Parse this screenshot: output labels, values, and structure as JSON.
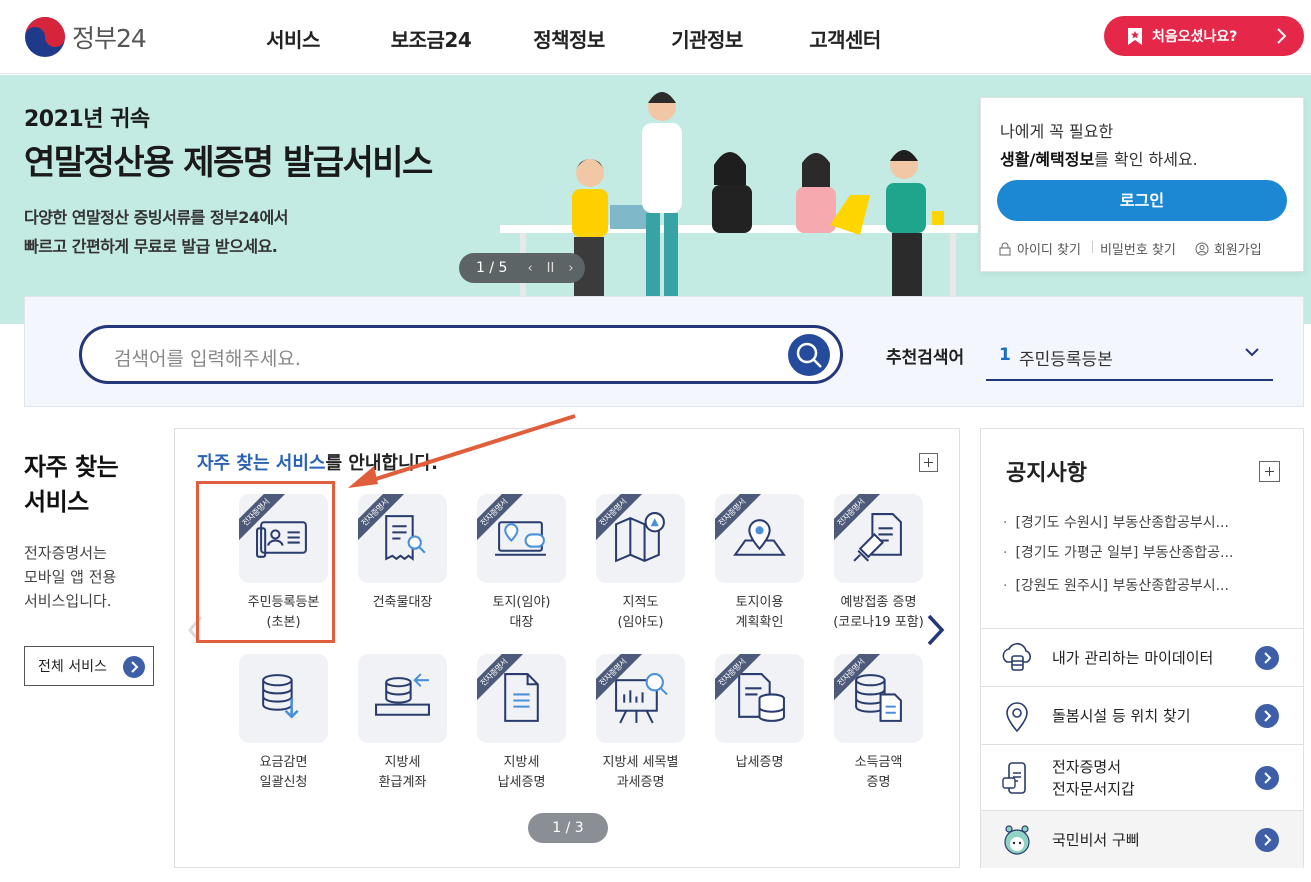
{
  "header": {
    "logo_text": "정부24",
    "nav": [
      "서비스",
      "보조금24",
      "정책정보",
      "기관정보",
      "고객센터"
    ],
    "first_visit_label": "처음오셨나요?"
  },
  "banner": {
    "subtitle": "2021년 귀속",
    "title": "연말정산용 제증명 발급서비스",
    "desc": "다양한 연말정산 증빙서류를 정부24에서\n빠르고 간편하게 무료로 발급 받으세요.",
    "slide_indicator": "1 / 5"
  },
  "login": {
    "line1": "나에게 꼭 필요한",
    "line2_bold": "생활/혜택정보",
    "line2_rest": "를 확인 하세요.",
    "button": "로그인",
    "find_id": "아이디 찾기",
    "find_pw": "비밀번호 찾기",
    "signup": "회원가입"
  },
  "search": {
    "placeholder": "검색어를 입력해주세요.",
    "recommend_label": "추천검색어",
    "recommend_num": "1",
    "recommend_text": "주민등록등본"
  },
  "favorites": {
    "title": "자주 찾는\n서비스",
    "desc": "전자증명서는\n모바일 앱 전용\n서비스입니다.",
    "all_button": "전체 서비스",
    "panel_head_highlight": "자주 찾는 서비스",
    "panel_head_rest": "를 안내합니다.",
    "ribbon_text": "전자증명서",
    "pager": "1 / 3",
    "services": [
      {
        "label": "주민등록등본\n(초본)",
        "icon": "id-card-icon",
        "ribbon": true
      },
      {
        "label": "건축물대장",
        "icon": "receipt-search-icon",
        "ribbon": true
      },
      {
        "label": "토지(임야)\n대장",
        "icon": "land-location-icon",
        "ribbon": true
      },
      {
        "label": "지적도\n(임야도)",
        "icon": "map-search-icon",
        "ribbon": true
      },
      {
        "label": "토지이용\n계획확인",
        "icon": "map-pin-icon",
        "ribbon": true
      },
      {
        "label": "예방접종 증명\n(코로나19 포함)",
        "icon": "vaccine-document-icon",
        "ribbon": true
      },
      {
        "label": "요금감면\n일괄신청",
        "icon": "database-download-icon",
        "ribbon": false
      },
      {
        "label": "지방세\n환급계좌",
        "icon": "database-refund-icon",
        "ribbon": false
      },
      {
        "label": "지방세\n납세증명",
        "icon": "document-icon",
        "ribbon": true
      },
      {
        "label": "지방세 세목별\n과세증명",
        "icon": "chart-board-icon",
        "ribbon": true
      },
      {
        "label": "납세증명",
        "icon": "document-database-icon",
        "ribbon": true
      },
      {
        "label": "소득금액\n증명",
        "icon": "database-document-icon",
        "ribbon": true
      }
    ]
  },
  "notice": {
    "title": "공지사항",
    "items": [
      "[경기도 수원시] 부동산종합공부시...",
      "[경기도 가평군 일부] 부동산종합공...",
      "[강원도 원주시] 부동산종합공부시..."
    ],
    "quick_links": [
      {
        "label": "내가 관리하는 마이데이터",
        "icon": "cloud-data-icon"
      },
      {
        "label": "돌봄시설 등 위치 찾기",
        "icon": "location-pin-icon"
      },
      {
        "label": "전자증명서\n전자문서지갑",
        "icon": "mobile-wallet-icon"
      },
      {
        "label": "국민비서 구삐",
        "icon": "gubbi-mascot-icon"
      }
    ]
  },
  "colors": {
    "brand_red": "#e5274a",
    "brand_blue": "#1c87d3",
    "navy": "#23377a",
    "banner_bg": "#c3ebe3",
    "highlight": "#e05e3b"
  }
}
